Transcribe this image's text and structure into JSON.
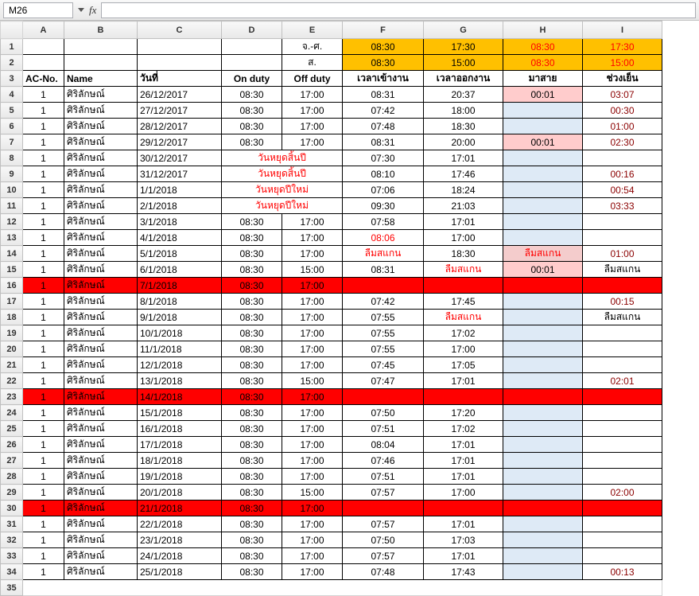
{
  "toolbar": {
    "cellref": "M26",
    "fx": "fx"
  },
  "cols": [
    "A",
    "B",
    "C",
    "D",
    "E",
    "F",
    "G",
    "H",
    "I"
  ],
  "header1": [
    "",
    "",
    "",
    "",
    "จ.-ศ.",
    "08:30",
    "17:30",
    "08:30",
    "17:30"
  ],
  "header2": [
    "",
    "",
    "",
    "",
    "ส.",
    "08:30",
    "15:00",
    "08:30",
    "15:00"
  ],
  "header3": [
    "AC-No.",
    "Name",
    "วันที่",
    "On duty",
    "Off duty",
    "เวลาเข้างาน",
    "เวลาออกงาน",
    "มาสาย",
    "ช่วงเย็น"
  ],
  "rows": [
    {
      "r": 4,
      "c": [
        "1",
        "ศิริลักษณ์",
        "26/12/2017",
        "08:30",
        "17:00",
        "08:31",
        "20:37",
        "00:01",
        "03:07"
      ],
      "hcls": "pink",
      "i": "txt-maroon"
    },
    {
      "r": 5,
      "c": [
        "1",
        "ศิริลักษณ์",
        "27/12/2017",
        "08:30",
        "17:00",
        "07:42",
        "18:00",
        "",
        "00:30"
      ],
      "hcls": "lblue",
      "i": "txt-maroon"
    },
    {
      "r": 6,
      "c": [
        "1",
        "ศิริลักษณ์",
        "28/12/2017",
        "08:30",
        "17:00",
        "07:48",
        "18:30",
        "",
        "01:00"
      ],
      "hcls": "lblue",
      "i": "txt-maroon"
    },
    {
      "r": 7,
      "c": [
        "1",
        "ศิริลักษณ์",
        "29/12/2017",
        "08:30",
        "17:00",
        "08:31",
        "20:00",
        "00:01",
        "02:30"
      ],
      "hcls": "pink",
      "i": "txt-maroon"
    },
    {
      "r": 8,
      "c": [
        "1",
        "ศิริลักษณ์",
        "30/12/2017",
        "วันหยุดสิ้นปี",
        "",
        "07:30",
        "17:01",
        "",
        ""
      ],
      "holiday": true,
      "hcls": "lblue"
    },
    {
      "r": 9,
      "c": [
        "1",
        "ศิริลักษณ์",
        "31/12/2017",
        "วันหยุดสิ้นปี",
        "",
        "08:10",
        "17:46",
        "",
        "00:16"
      ],
      "holiday": true,
      "hcls": "lblue",
      "i": "txt-maroon"
    },
    {
      "r": 10,
      "c": [
        "1",
        "ศิริลักษณ์",
        "1/1/2018",
        "วันหยุดปีใหม่",
        "",
        "07:06",
        "18:24",
        "",
        "00:54"
      ],
      "holiday": true,
      "hcls": "lblue",
      "i": "txt-maroon"
    },
    {
      "r": 11,
      "c": [
        "1",
        "ศิริลักษณ์",
        "2/1/2018",
        "วันหยุดปีใหม่",
        "",
        "09:30",
        "21:03",
        "",
        "03:33"
      ],
      "holiday": true,
      "hcls": "lblue",
      "i": "txt-maroon"
    },
    {
      "r": 12,
      "c": [
        "1",
        "ศิริลักษณ์",
        "3/1/2018",
        "08:30",
        "17:00",
        "07:58",
        "17:01",
        "",
        ""
      ],
      "hcls": "lblue"
    },
    {
      "r": 13,
      "c": [
        "1",
        "ศิริลักษณ์",
        "4/1/2018",
        "08:30",
        "17:00",
        "08:06",
        "17:00",
        "",
        ""
      ],
      "fcls": "txt-red",
      "hcls": "lblue"
    },
    {
      "r": 14,
      "c": [
        "1",
        "ศิริลักษณ์",
        "5/1/2018",
        "08:30",
        "17:00",
        "ลืมสแกน",
        "18:30",
        "ลืมสแกน",
        "01:00"
      ],
      "fcls": "txt-red",
      "hcls": "pink2",
      "htxt": "txt-red",
      "i": "txt-maroon"
    },
    {
      "r": 15,
      "c": [
        "1",
        "ศิริลักษณ์",
        "6/1/2018",
        "08:30",
        "15:00",
        "08:31",
        "ลืมสแกน",
        "00:01",
        "ลืมสแกน"
      ],
      "gcls": "txt-red",
      "hcls": "pink"
    },
    {
      "r": 16,
      "c": [
        "1",
        "ศิริลักษณ์",
        "7/1/2018",
        "08:30",
        "17:00",
        "",
        "",
        "",
        ""
      ],
      "rowcls": "red-row"
    },
    {
      "r": 17,
      "c": [
        "1",
        "ศิริลักษณ์",
        "8/1/2018",
        "08:30",
        "17:00",
        "07:42",
        "17:45",
        "",
        "00:15"
      ],
      "hcls": "lblue",
      "i": "txt-maroon"
    },
    {
      "r": 18,
      "c": [
        "1",
        "ศิริลักษณ์",
        "9/1/2018",
        "08:30",
        "17:00",
        "07:55",
        "ลืมสแกน",
        "",
        "ลืมสแกน"
      ],
      "gcls": "txt-red",
      "hcls": "lblue"
    },
    {
      "r": 19,
      "c": [
        "1",
        "ศิริลักษณ์",
        "10/1/2018",
        "08:30",
        "17:00",
        "07:55",
        "17:02",
        "",
        ""
      ],
      "hcls": "lblue"
    },
    {
      "r": 20,
      "c": [
        "1",
        "ศิริลักษณ์",
        "11/1/2018",
        "08:30",
        "17:00",
        "07:55",
        "17:00",
        "",
        ""
      ],
      "hcls": "lblue"
    },
    {
      "r": 21,
      "c": [
        "1",
        "ศิริลักษณ์",
        "12/1/2018",
        "08:30",
        "17:00",
        "07:45",
        "17:05",
        "",
        ""
      ],
      "hcls": "lblue"
    },
    {
      "r": 22,
      "c": [
        "1",
        "ศิริลักษณ์",
        "13/1/2018",
        "08:30",
        "15:00",
        "07:47",
        "17:01",
        "",
        "02:01"
      ],
      "hcls": "lblue",
      "i": "txt-maroon"
    },
    {
      "r": 23,
      "c": [
        "1",
        "ศิริลักษณ์",
        "14/1/2018",
        "08:30",
        "17:00",
        "",
        "",
        "",
        ""
      ],
      "rowcls": "red-row"
    },
    {
      "r": 24,
      "c": [
        "1",
        "ศิริลักษณ์",
        "15/1/2018",
        "08:30",
        "17:00",
        "07:50",
        "17:20",
        "",
        ""
      ],
      "hcls": "lblue"
    },
    {
      "r": 25,
      "c": [
        "1",
        "ศิริลักษณ์",
        "16/1/2018",
        "08:30",
        "17:00",
        "07:51",
        "17:02",
        "",
        ""
      ],
      "hcls": "lblue"
    },
    {
      "r": 26,
      "c": [
        "1",
        "ศิริลักษณ์",
        "17/1/2018",
        "08:30",
        "17:00",
        "08:04",
        "17:01",
        "",
        ""
      ],
      "hcls": "lblue"
    },
    {
      "r": 27,
      "c": [
        "1",
        "ศิริลักษณ์",
        "18/1/2018",
        "08:30",
        "17:00",
        "07:46",
        "17:01",
        "",
        ""
      ],
      "hcls": "lblue"
    },
    {
      "r": 28,
      "c": [
        "1",
        "ศิริลักษณ์",
        "19/1/2018",
        "08:30",
        "17:00",
        "07:51",
        "17:01",
        "",
        ""
      ],
      "hcls": "lblue"
    },
    {
      "r": 29,
      "c": [
        "1",
        "ศิริลักษณ์",
        "20/1/2018",
        "08:30",
        "15:00",
        "07:57",
        "17:00",
        "",
        "02:00"
      ],
      "hcls": "lblue",
      "i": "txt-maroon"
    },
    {
      "r": 30,
      "c": [
        "1",
        "ศิริลักษณ์",
        "21/1/2018",
        "08:30",
        "17:00",
        "",
        "",
        "",
        ""
      ],
      "rowcls": "red-row"
    },
    {
      "r": 31,
      "c": [
        "1",
        "ศิริลักษณ์",
        "22/1/2018",
        "08:30",
        "17:00",
        "07:57",
        "17:01",
        "",
        ""
      ],
      "hcls": "lblue"
    },
    {
      "r": 32,
      "c": [
        "1",
        "ศิริลักษณ์",
        "23/1/2018",
        "08:30",
        "17:00",
        "07:50",
        "17:03",
        "",
        ""
      ],
      "hcls": "lblue"
    },
    {
      "r": 33,
      "c": [
        "1",
        "ศิริลักษณ์",
        "24/1/2018",
        "08:30",
        "17:00",
        "07:57",
        "17:01",
        "",
        ""
      ],
      "hcls": "lblue"
    },
    {
      "r": 34,
      "c": [
        "1",
        "ศิริลักษณ์",
        "25/1/2018",
        "08:30",
        "17:00",
        "07:48",
        "17:43",
        "",
        "00:13"
      ],
      "hcls": "lblue",
      "i": "txt-maroon"
    }
  ]
}
